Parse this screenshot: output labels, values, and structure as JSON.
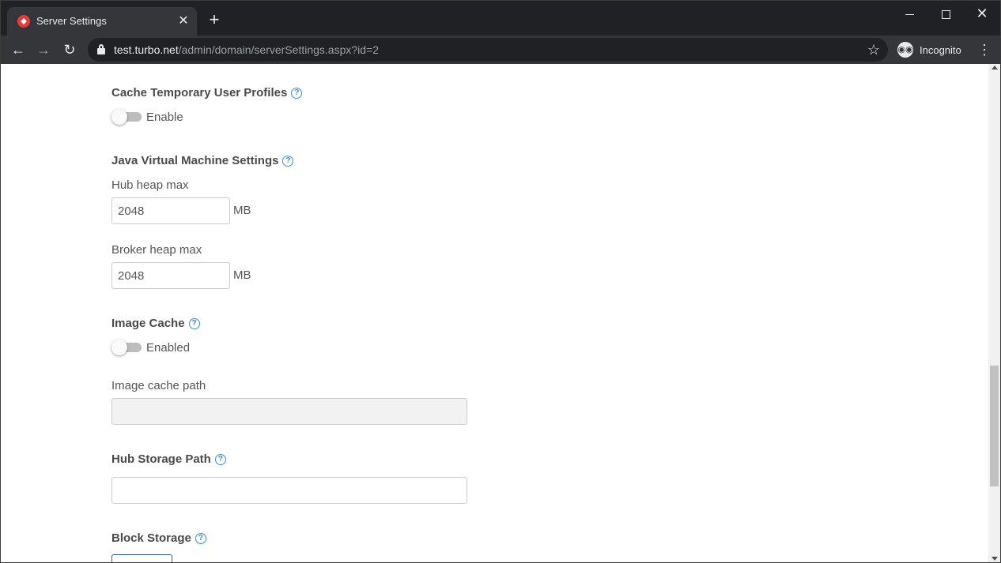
{
  "browser": {
    "tab_title": "Server Settings",
    "url_host": "test.turbo.net",
    "url_path": "/admin/domain/serverSettings.aspx?id=2",
    "profile_label": "Incognito"
  },
  "page": {
    "cache_profiles": {
      "heading": "Cache Temporary User Profiles",
      "toggle_label": "Enable",
      "enabled": false
    },
    "jvm": {
      "heading": "Java Virtual Machine Settings",
      "hub_heap_label": "Hub heap max",
      "hub_heap_value": "2048",
      "broker_heap_label": "Broker heap max",
      "broker_heap_value": "2048",
      "unit": "MB"
    },
    "image_cache": {
      "heading": "Image Cache",
      "toggle_label": "Enabled",
      "enabled": false,
      "path_label": "Image cache path",
      "path_value": ""
    },
    "hub_storage": {
      "heading": "Hub Storage Path",
      "path_value": ""
    },
    "block_storage": {
      "heading": "Block Storage"
    }
  },
  "colors": {
    "accent": "#3a8ed4",
    "heading_text": "#4a4a4a",
    "body_text": "#555555"
  }
}
